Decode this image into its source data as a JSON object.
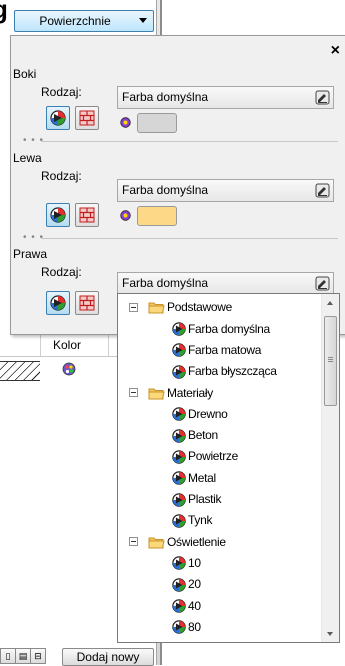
{
  "colors": {
    "accent": "#3c7fb1",
    "swatch_boki": "#d6d6d6",
    "swatch_lewa": "#fdd987",
    "folder": "#f3c560"
  },
  "background": {
    "header_fragment": "g",
    "kolor_header": "Kolor",
    "dodaj_button": "Dodaj nowy",
    "icons": [
      "palette-icon",
      "page-icon",
      "picker-icon"
    ]
  },
  "top_dropdown": {
    "label": "Powierzchnie"
  },
  "panel": {
    "close": "×",
    "sections": [
      {
        "title": "Boki",
        "rodzaj_label": "Rodzaj:",
        "material": "Farba domyślna"
      },
      {
        "title": "Lewa",
        "rodzaj_label": "Rodzaj:",
        "material": "Farba domyślna"
      },
      {
        "title": "Prawa",
        "rodzaj_label": "Rodzaj:",
        "material": "Farba domyślna"
      }
    ],
    "separator": "• • •"
  },
  "tree": {
    "groups": [
      {
        "label": "Podstawowe",
        "items": [
          "Farba domyślna",
          "Farba matowa",
          "Farba błyszcząca"
        ]
      },
      {
        "label": "Materiały",
        "items": [
          "Drewno",
          "Beton",
          "Powietrze",
          "Metal",
          "Plastik",
          "Tynk"
        ]
      },
      {
        "label": "Oświetlenie",
        "items": [
          "10",
          "20",
          "40",
          "80"
        ]
      }
    ]
  }
}
